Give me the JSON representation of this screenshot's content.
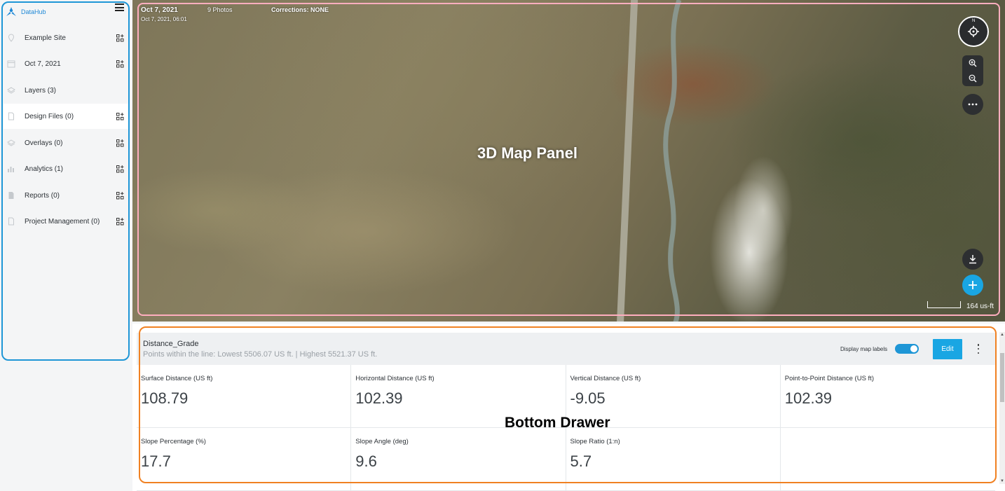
{
  "sidebar": {
    "brand": "DataHub",
    "items": [
      {
        "label": "Example Site",
        "icon": "location-pin-icon"
      },
      {
        "label": "Oct 7, 2021",
        "icon": "calendar-icon"
      },
      {
        "label": "Layers (3)",
        "icon": "layers-icon"
      },
      {
        "label": "Design Files (0)",
        "icon": "file-icon"
      },
      {
        "label": "Overlays (0)",
        "icon": "overlay-icon"
      },
      {
        "label": "Analytics (1)",
        "icon": "bar-chart-icon"
      },
      {
        "label": "Reports (0)",
        "icon": "report-icon"
      },
      {
        "label": "Project Management (0)",
        "icon": "document-icon"
      }
    ]
  },
  "map": {
    "date": "Oct 7, 2021",
    "datetime": "Oct 7, 2021, 06:01",
    "photos": "9 Photos",
    "corrections": "Corrections: NONE",
    "panel_label": "3D Map Panel",
    "compass_north": "N",
    "scale_label": "164 us-ft"
  },
  "drawer": {
    "title": "Distance_Grade",
    "subtitle": "Points within the line: Lowest 5506.07 US ft. | Highest 5521.37 US ft.",
    "toggle_label": "Display map labels",
    "toggle_on": true,
    "edit_label": "Edit",
    "panel_label": "Bottom Drawer",
    "metrics": [
      {
        "label": "Surface Distance (US ft)",
        "value": "108.79"
      },
      {
        "label": "Horizontal Distance (US ft)",
        "value": "102.39"
      },
      {
        "label": "Vertical Distance (US ft)",
        "value": "-9.05"
      },
      {
        "label": "Point-to-Point Distance (US ft)",
        "value": "102.39"
      },
      {
        "label": "Slope Percentage (%)",
        "value": "17.7"
      },
      {
        "label": "Slope Angle (deg)",
        "value": "9.6"
      },
      {
        "label": "Slope Ratio (1:n)",
        "value": "5.7"
      },
      {
        "label": "",
        "value": ""
      }
    ]
  },
  "colors": {
    "accent": "#19a6e3",
    "sidebar_outline": "#1e96d6",
    "map_outline": "#ffaebf",
    "drawer_outline": "#f08122"
  }
}
